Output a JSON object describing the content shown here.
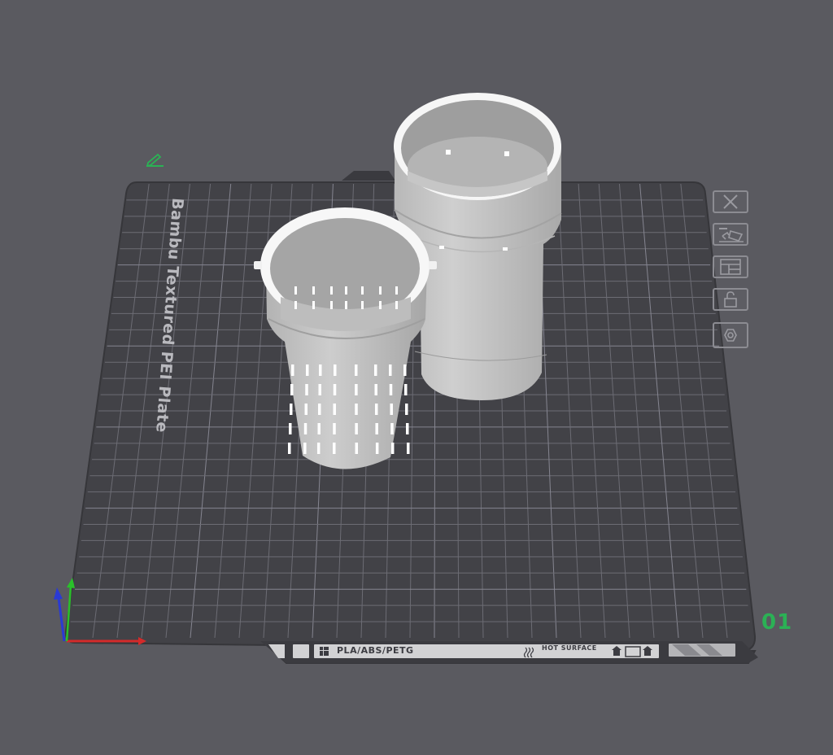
{
  "plate": {
    "name": "Bambu Textured PEI Plate",
    "number": "01",
    "material": "PLA/ABS/PETG",
    "hot_surface": "HOT SURFACE"
  },
  "toolbar": {
    "items": [
      {
        "name": "remove-plate-icon"
      },
      {
        "name": "auto-orient-icon"
      },
      {
        "name": "arrange-icon"
      },
      {
        "name": "lock-icon"
      },
      {
        "name": "plate-settings-icon"
      }
    ]
  },
  "objects": [
    {
      "name": "strainer-basket"
    },
    {
      "name": "outer-cylinder"
    }
  ],
  "colors": {
    "background": "#5a5a60",
    "plate": "#424247",
    "grid": "#7d7d85",
    "model": "#c4c4c4",
    "accent_green": "#2bb155",
    "axis_x": "#d42a2a",
    "axis_y": "#2ac02a",
    "axis_z": "#2a3ad4"
  }
}
